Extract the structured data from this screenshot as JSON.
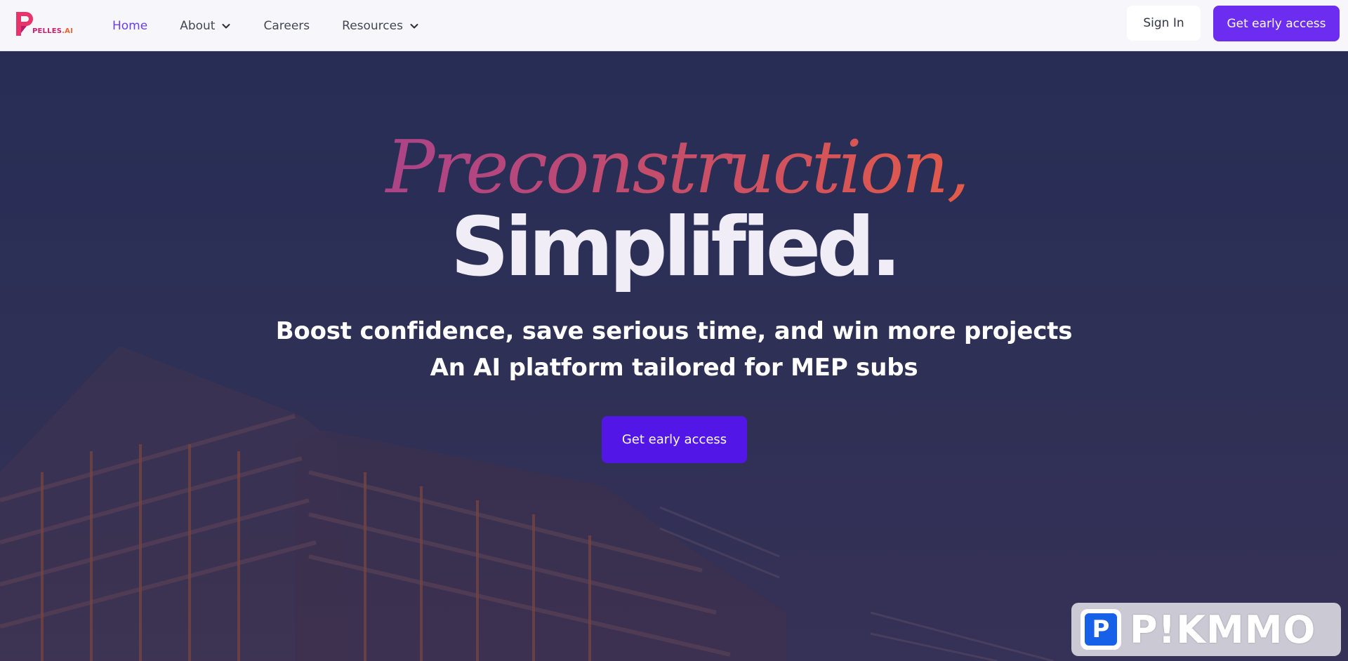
{
  "brand": {
    "name": "PELLES",
    "suffix": ".AI",
    "icon": "pelles-logo-icon",
    "colors": {
      "primary": "#c9206b",
      "secondary": "#f0652f"
    }
  },
  "nav": {
    "items": [
      {
        "label": "Home",
        "active": true,
        "has_dropdown": false
      },
      {
        "label": "About",
        "active": false,
        "has_dropdown": true
      },
      {
        "label": "Careers",
        "active": false,
        "has_dropdown": false
      },
      {
        "label": "Resources",
        "active": false,
        "has_dropdown": true
      }
    ],
    "signin_label": "Sign In",
    "cta_label": "Get early access",
    "active_color": "#6a40e6",
    "cta_color": "#6c2df0"
  },
  "hero": {
    "headline_script": "Preconstruction,",
    "headline_main": "Simplified.",
    "subtitle_line1": "Boost confidence, save serious time, and win more projects",
    "subtitle_line2": "An AI platform tailored for MEP subs",
    "cta_label": "Get early access",
    "cta_color": "#5217e6",
    "background": "construction-scaffolding-image",
    "overlay_color": "#272d55"
  },
  "watermark": {
    "badge_letter": "P",
    "text": "P!KMMO"
  }
}
